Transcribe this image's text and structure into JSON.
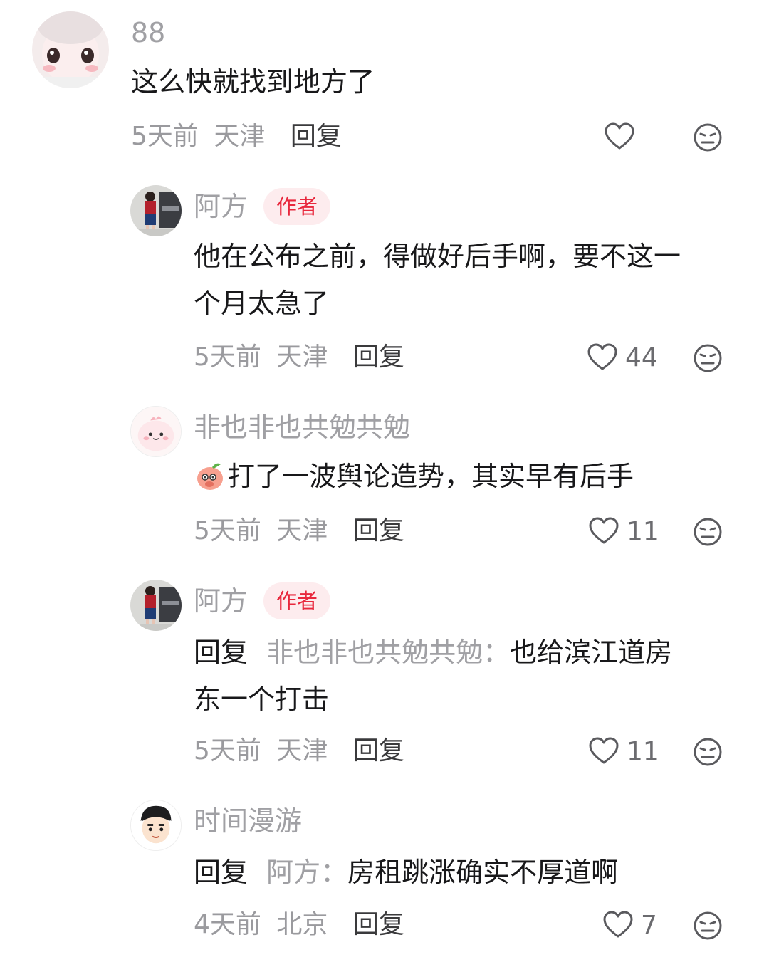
{
  "comments": [
    {
      "username": "88",
      "avatar": "girl-doll-avatar",
      "text": "这么快就找到地方了",
      "time": "5天前",
      "location": "天津",
      "reply_label": "回复",
      "likes": ""
    },
    {
      "username": "阿方",
      "avatar": "woman-photo-avatar",
      "badge": "作者",
      "text_line1": "他在公布之前，得做好后手啊，要不这一",
      "text_line2": "个月太急了",
      "time": "5天前",
      "location": "天津",
      "reply_label": "回复",
      "likes": "44"
    },
    {
      "username": "非也非也共勉共勉",
      "avatar": "pink-blob-avatar",
      "emoji": "peach-face-emoji",
      "text": "打了一波舆论造势，其实早有后手",
      "time": "5天前",
      "location": "天津",
      "reply_label": "回复",
      "likes": "11"
    },
    {
      "username": "阿方",
      "avatar": "woman-photo-avatar",
      "badge": "作者",
      "reply_prefix": "回复",
      "mention": "非也非也共勉共勉：",
      "text_line1": "也给滨江道房",
      "text_line2": "东一个打击",
      "time": "5天前",
      "location": "天津",
      "reply_label": "回复",
      "likes": "11"
    },
    {
      "username": "时间漫游",
      "avatar": "cartoon-boy-avatar",
      "reply_prefix": "回复",
      "mention": "阿方：",
      "text": "房租跳涨确实不厚道啊",
      "time": "4天前",
      "location": "北京",
      "reply_label": "回复",
      "likes": "7"
    }
  ],
  "colors": {
    "badge_bg": "#fdecee",
    "badge_text": "#e8283d",
    "name": "#a0a0a4",
    "meta": "#9a9a9e",
    "body_text": "#18181a"
  }
}
